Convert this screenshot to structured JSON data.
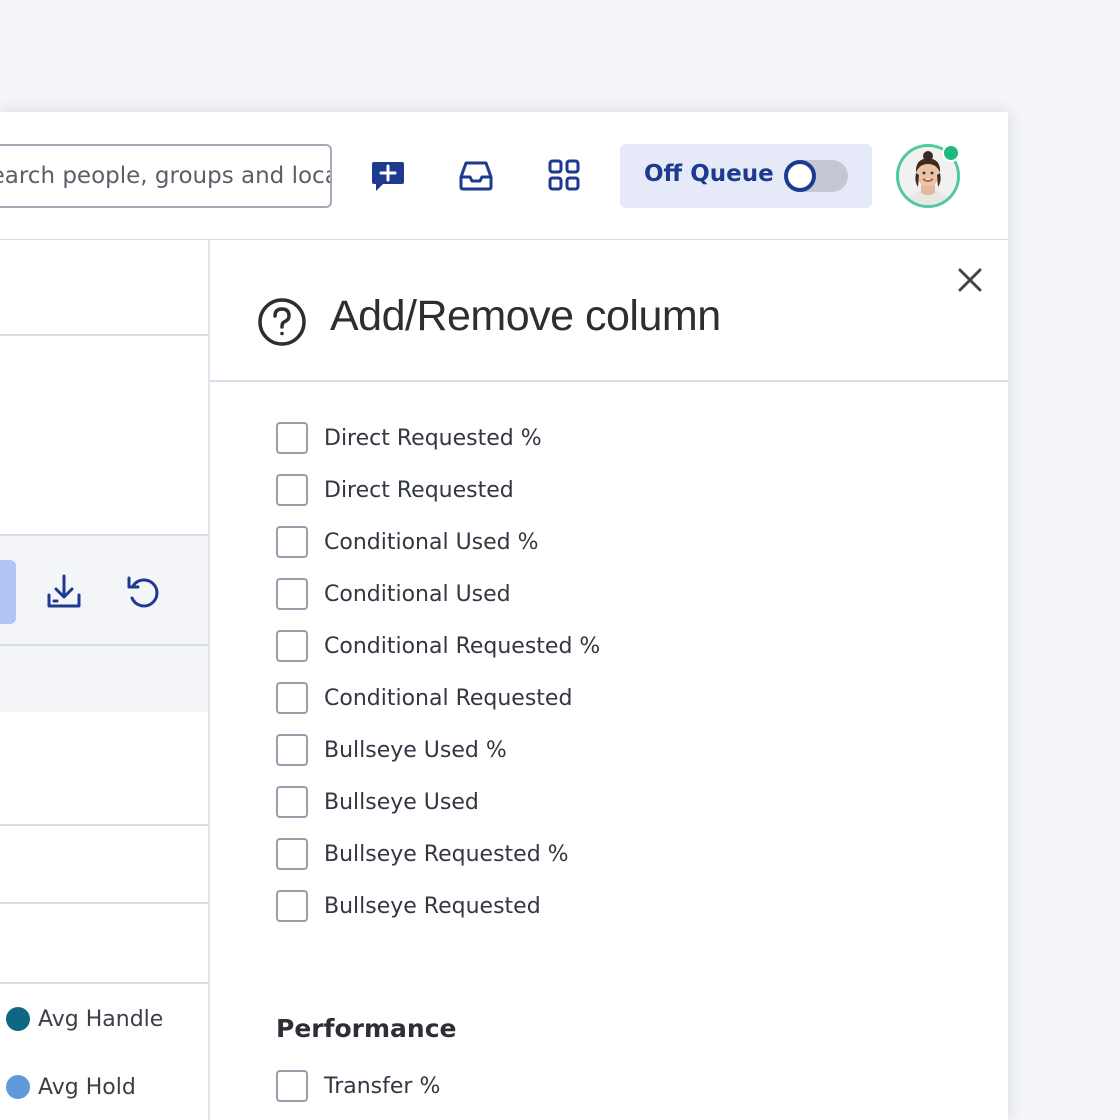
{
  "header": {
    "search_placeholder": "Search people, groups and locations",
    "icons": [
      "new-message-icon",
      "inbox-icon",
      "apps-grid-icon"
    ],
    "queue_label": "Off Queue",
    "queue_on": false,
    "presence": "available"
  },
  "left_panel": {
    "legend": [
      {
        "label": "Avg Handle",
        "color": "#0f6883"
      },
      {
        "label": "Avg Hold",
        "color": "#5f99d9"
      }
    ]
  },
  "drawer": {
    "title": "Add/Remove column",
    "columns": [
      {
        "label": "Direct Requested %",
        "checked": false
      },
      {
        "label": "Direct Requested",
        "checked": false
      },
      {
        "label": "Conditional Used %",
        "checked": false
      },
      {
        "label": "Conditional Used",
        "checked": false
      },
      {
        "label": "Conditional Requested %",
        "checked": false
      },
      {
        "label": "Conditional Requested",
        "checked": false
      },
      {
        "label": "Bullseye Used %",
        "checked": false
      },
      {
        "label": "Bullseye Used",
        "checked": false
      },
      {
        "label": "Bullseye Requested %",
        "checked": false
      },
      {
        "label": "Bullseye Requested",
        "checked": false
      }
    ],
    "performance": {
      "title": "Performance",
      "columns": [
        {
          "label": "Transfer %",
          "checked": false
        }
      ]
    }
  },
  "colors": {
    "brand": "#1e3a8f",
    "presence": "#1db980",
    "accent_light": "#e6e9f7"
  }
}
